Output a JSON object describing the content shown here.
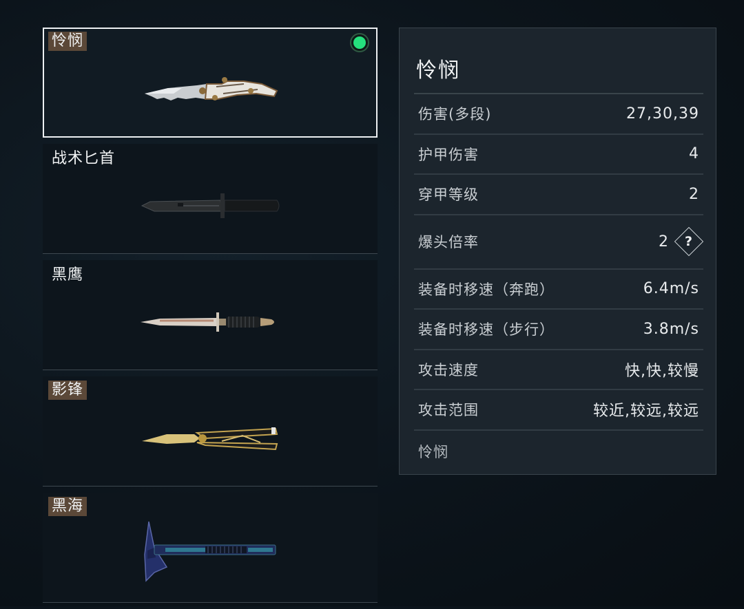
{
  "weapons": [
    {
      "name": "怜悯",
      "tag_style": "tag",
      "selected": true,
      "equipped": true
    },
    {
      "name": "战术匕首",
      "tag_style": "plain",
      "selected": false,
      "equipped": false
    },
    {
      "name": "黑鹰",
      "tag_style": "plain",
      "selected": false,
      "equipped": false
    },
    {
      "name": "影锋",
      "tag_style": "tag",
      "selected": false,
      "equipped": false
    },
    {
      "name": "黑海",
      "tag_style": "tag",
      "selected": false,
      "equipped": false
    }
  ],
  "detail": {
    "title": "怜悯",
    "stats": [
      {
        "label": "伤害(多段)",
        "value": "27,30,39"
      },
      {
        "label": "护甲伤害",
        "value": "4"
      },
      {
        "label": "穿甲等级",
        "value": "2"
      },
      {
        "label": "爆头倍率",
        "value": "2"
      },
      {
        "label": "装备时移速（奔跑）",
        "value": "6.4m/s"
      },
      {
        "label": "装备时移速（步行）",
        "value": "3.8m/s"
      },
      {
        "label": "攻击速度",
        "value": "快,快,较慢"
      },
      {
        "label": "攻击范围",
        "value": "较近,较远,较远"
      }
    ],
    "help_glyph": "?",
    "footer": "怜悯"
  },
  "colors": {
    "equipped": "#25e07d",
    "name_tag_bg": "#5b4838",
    "panel_bg": "#1c252d",
    "selected_border": "#eef1f3"
  },
  "icons": {
    "equipped": "equipped-indicator-icon",
    "help": "help-icon"
  }
}
